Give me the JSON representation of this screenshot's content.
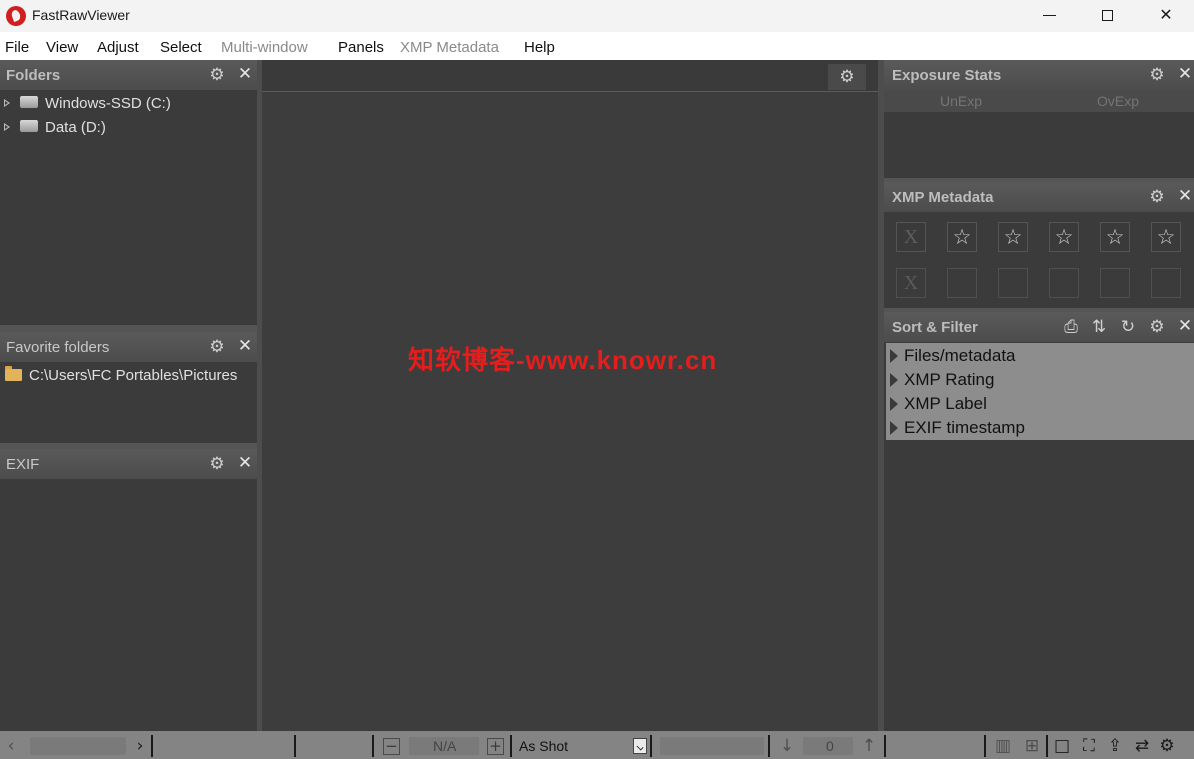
{
  "window": {
    "title": "FastRawViewer"
  },
  "menu": [
    {
      "label": "File",
      "enabled": true
    },
    {
      "label": "View",
      "enabled": true
    },
    {
      "label": "Adjust",
      "enabled": true
    },
    {
      "label": "Select",
      "enabled": true
    },
    {
      "label": "Multi-window",
      "enabled": false
    },
    {
      "label": "Panels",
      "enabled": true
    },
    {
      "label": "XMP Metadata",
      "enabled": false
    },
    {
      "label": "Help",
      "enabled": true
    }
  ],
  "folders_panel": {
    "title": "Folders",
    "items": [
      {
        "label": "Windows-SSD (C:)",
        "icon": "drive-icon"
      },
      {
        "label": "Data (D:)",
        "icon": "drive-icon"
      }
    ]
  },
  "favorites_panel": {
    "title": "Favorite folders",
    "items": [
      {
        "label": "C:\\Users\\FC Portables\\Pictures",
        "icon": "folder-icon"
      }
    ]
  },
  "exif_panel": {
    "title": "EXIF"
  },
  "viewer": {
    "watermark": "知软博客-www.knowr.cn"
  },
  "exposure_panel": {
    "title": "Exposure Stats",
    "columns": [
      "UnExp",
      "OvExp"
    ]
  },
  "xmp_panel": {
    "title": "XMP Metadata",
    "reject_symbol": "X",
    "star_symbol": "☆",
    "star_count": 5,
    "label_slot_count": 5
  },
  "sort_filter_panel": {
    "title": "Sort & Filter",
    "items": [
      "Files/metadata",
      "XMP Rating",
      "XMP Label",
      "EXIF timestamp"
    ]
  },
  "statusbar": {
    "zoom_value": "N/A",
    "white_balance": "As Shot",
    "count_value": "0"
  },
  "colors": {
    "panel_bg": "#3b3b3b",
    "header_bg": "#525252",
    "statusbar_bg": "#848484",
    "sort_filter_bg": "#8d8d8d",
    "watermark": "#e41d1d"
  }
}
